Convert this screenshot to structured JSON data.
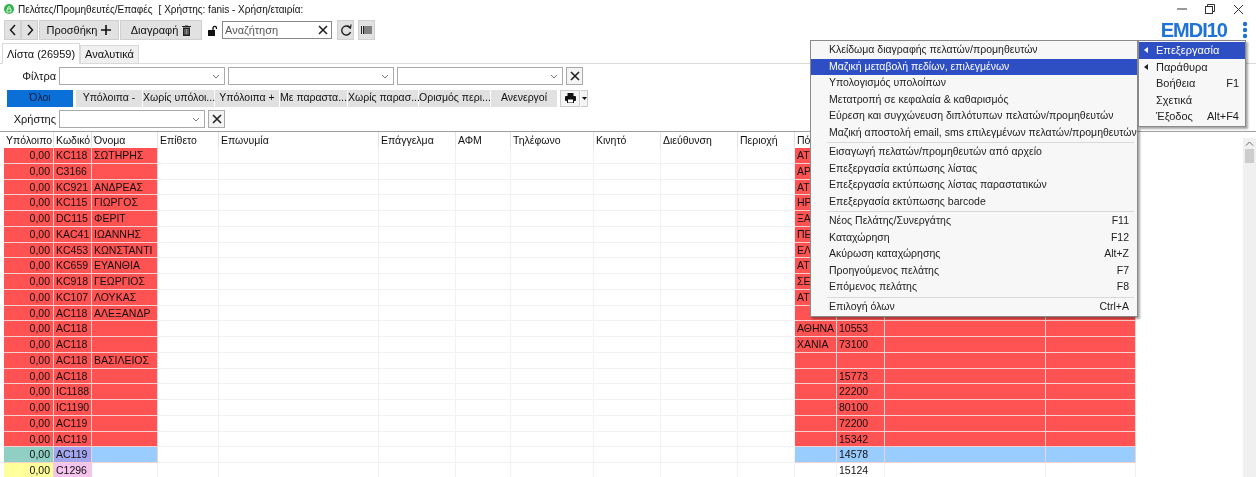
{
  "window": {
    "title": "Πελάτες/Προμηθευτές/Επαφές",
    "subtitle": "[ Χρήστης: fanis - Χρήση/εταιρία:"
  },
  "toolbar": {
    "add_button": "Προσθήκη",
    "delete_button": "Διαγραφή",
    "search": {
      "placeholder": "Αναζήτηση"
    }
  },
  "logo": "EMDI10",
  "tabs": [
    {
      "label": "Λίστα (26959)",
      "selected": true
    },
    {
      "label": "Αναλυτικά",
      "selected": false
    }
  ],
  "filters": {
    "label": "Φίλτρα",
    "user_label": "Χρήστης"
  },
  "quick_filters": [
    {
      "label": "Όλοι",
      "selected": true
    },
    {
      "label": "Υπόλοιπα -",
      "selected": false
    },
    {
      "label": "Χωρίς υπόλοι...",
      "selected": false
    },
    {
      "label": "Υπόλοιπα +",
      "selected": false
    },
    {
      "label": "Με παραστα...",
      "selected": false
    },
    {
      "label": "Χωρίς παρασ...",
      "selected": false
    },
    {
      "label": "Ορισμός περι...",
      "selected": false
    },
    {
      "label": "Ανενεργοί",
      "selected": false
    }
  ],
  "table": {
    "columns": [
      "Υπόλοιπο",
      "Κωδικό",
      "Όνομα",
      "Επίθετο",
      "Επωνυμία",
      "Επάγγελμα",
      "ΑΦΜ",
      "Τηλέφωνο",
      "Κινητό",
      "Διεύθυνση",
      "Περιοχή",
      "Πό"
    ],
    "rows": [
      {
        "balance": "0,00",
        "code": "KC118",
        "name": "ΣΩΤΗΡΗΣ",
        "city": "ΑΤ",
        "highlighted": true,
        "selected": false
      },
      {
        "balance": "0,00",
        "code": "C3166",
        "city": "ΑΡ",
        "highlighted": true,
        "selected": false
      },
      {
        "balance": "0,00",
        "code": "KC921",
        "name": "ΑΝΔΡΕΑΣ",
        "city": "ΑΤ",
        "highlighted": true,
        "selected": false
      },
      {
        "balance": "0,00",
        "code": "KC115",
        "name": "ΓΙΩΡΓΟΣ",
        "city": "ΗΡ",
        "highlighted": true,
        "selected": false
      },
      {
        "balance": "0,00",
        "code": "DC115",
        "name": "ΦΕΡΙΤ",
        "city": "ΞΑ",
        "highlighted": true,
        "selected": false
      },
      {
        "balance": "0,00",
        "code": "KAC41",
        "name": "ΙΩΑΝΝΗΣ",
        "city": "ΠΕ",
        "highlighted": true,
        "selected": false
      },
      {
        "balance": "0,00",
        "code": "KC453",
        "name": "ΚΩΝΣΤΑΝΤΙ",
        "city": "ΕΛ",
        "highlighted": true,
        "selected": false
      },
      {
        "balance": "0,00",
        "code": "KC659",
        "name": "ΕΥΑΝΘΙΑ",
        "city": "ΑΤ",
        "highlighted": true,
        "selected": false
      },
      {
        "balance": "0,00",
        "code": "KC918",
        "name": "ΓΕΩΡΓΙΟΣ",
        "city": "ΣΕ",
        "highlighted": true,
        "selected": false
      },
      {
        "balance": "0,00",
        "code": "KC107",
        "name": "ΛΟΥΚΑΣ",
        "city": "ΑΤ",
        "highlighted": true,
        "selected": false
      },
      {
        "balance": "0,00",
        "code": "AC118",
        "name": "ΑΛΕΞΑΝΔΡ",
        "highlighted": true,
        "selected": false
      },
      {
        "balance": "0,00",
        "code": "AC118",
        "city": "ΑΘΗΝΑ",
        "postal_code": "10553",
        "highlighted": true,
        "selected": false
      },
      {
        "balance": "0,00",
        "code": "AC118",
        "city": "ΧΑΝΙΑ",
        "postal_code": "73100",
        "highlighted": true,
        "selected": false
      },
      {
        "balance": "0,00",
        "code": "AC118",
        "name": "ΒΑΣΙΛΕΙΟΣ",
        "highlighted": true,
        "selected": false
      },
      {
        "balance": "0,00",
        "code": "AC118",
        "postal_code": "15773",
        "highlighted": true,
        "selected": false
      },
      {
        "balance": "0,00",
        "code": "IC1188",
        "postal_code": "22200",
        "highlighted": true,
        "selected": false
      },
      {
        "balance": "0,00",
        "code": "IC1190",
        "postal_code": "80100",
        "highlighted": true,
        "selected": false
      },
      {
        "balance": "0,00",
        "code": "AC119",
        "postal_code": "72200",
        "highlighted": true,
        "selected": false
      },
      {
        "balance": "0,00",
        "code": "AC119",
        "postal_code": "15342",
        "highlighted": true,
        "selected": false
      },
      {
        "balance": "0,00",
        "code": "AC119",
        "postal_code": "14578",
        "highlighted": false,
        "selected": true
      },
      {
        "balance": "0,00",
        "code": "C1296",
        "postal_code": "15124",
        "highlighted": false,
        "selected": false
      }
    ]
  },
  "edit_menu": {
    "groups": [
      [
        {
          "label": "Κλείδωμα διαγραφής πελατών/προμηθευτών",
          "selected": false
        },
        {
          "label": "Μαζική μεταβολή πεδίων, επιλεγμένων",
          "selected": true
        },
        {
          "label": "Υπολογισμός υπολοίπων",
          "selected": false
        },
        {
          "label": "Μετατροπή σε κεφαλαία & καθαρισμός",
          "selected": false
        },
        {
          "label": "Εύρεση και συγχώνευση διπλότυπων πελατών/προμηθευτών",
          "selected": false
        },
        {
          "label": "Μαζική αποστολή email, sms επιλεγμένων πελατών/προμηθευτών",
          "selected": false
        }
      ],
      [
        {
          "label": "Εισαγωγή πελατών/προμηθευτών από αρχείο",
          "selected": false
        },
        {
          "label": "Επεξεργασία εκτύπωσης λίστας",
          "selected": false
        },
        {
          "label": "Επεξεργασία εκτύπωσης λίστας παραστατικών",
          "selected": false
        },
        {
          "label": "Επεξεργασία εκτύπωσης barcode",
          "selected": false
        }
      ],
      [
        {
          "label": "Νέος Πελάτης/Συνεργάτης",
          "shortcut": "F11",
          "selected": false
        },
        {
          "label": "Καταχώρηση",
          "shortcut": "F12",
          "selected": false
        },
        {
          "label": "Ακύρωση καταχώρησης",
          "shortcut": "Alt+Z",
          "selected": false
        },
        {
          "label": "Προηγούμενος πελάτης",
          "shortcut": "F7",
          "selected": false
        },
        {
          "label": "Επόμενος πελάτης",
          "shortcut": "F8",
          "selected": false
        }
      ],
      [
        {
          "label": "Επιλογή όλων",
          "shortcut": "Ctrl+A",
          "selected": false
        }
      ]
    ]
  },
  "main_menu": [
    {
      "label": "Επεξεργασία",
      "kind": "submenu",
      "selected": true
    },
    {
      "label": "Παράθυρα",
      "kind": "submenu",
      "selected": false
    },
    {
      "label": "Βοήθεια",
      "kind": "item",
      "shortcut": "F1",
      "selected": false
    },
    {
      "label": "Σχετικά",
      "kind": "item",
      "selected": false
    },
    {
      "label": "Έξοδος",
      "kind": "item",
      "shortcut": "Alt+F4",
      "selected": false
    }
  ]
}
